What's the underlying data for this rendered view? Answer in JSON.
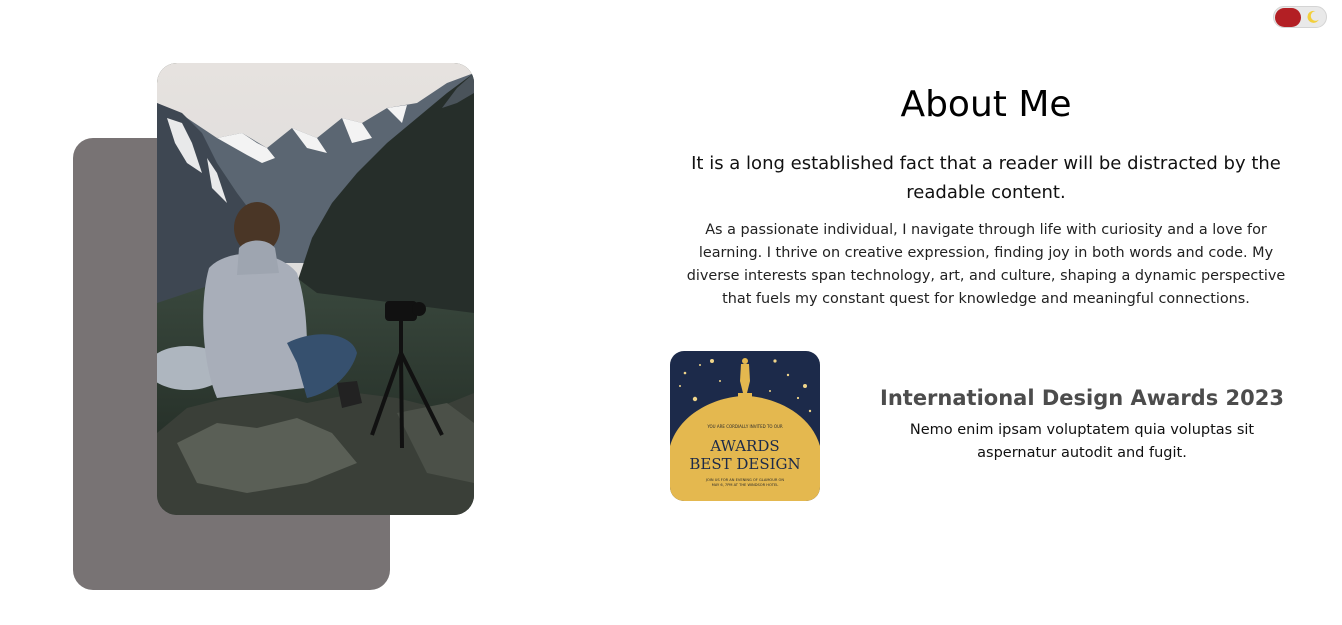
{
  "theme_toggle": {
    "knob_color": "#b31f24",
    "icon": "moon-icon"
  },
  "about": {
    "title": "About Me",
    "lead": "It is a long established fact that a reader will be distracted by the readable content.",
    "body": "As a passionate individual, I navigate through life with curiosity and a love for learning. I thrive on creative expression, finding joy in both words and code. My diverse interests span technology, art, and culture, shaping a dynamic perspective that fuels my constant quest for knowledge and meaningful connections."
  },
  "award": {
    "badge": {
      "top_line": "YOU ARE CORDIALLY INVITED TO OUR",
      "line1": "AWARDS",
      "line2": "BEST DESIGN",
      "bottom_line1": "JOIN US FOR AN EVENING OF GLAMOUR ON",
      "bottom_line2": "MAY 6, 7PM AT THE WINDSOR HOTEL",
      "navy": "#1c2a4a",
      "gold": "#e4b84f"
    },
    "title": "International Design Awards 2023",
    "description": "Nemo enim ipsam voluptatem quia voluptas sit aspernatur autodit and fugit."
  },
  "colors": {
    "back_card": "#787374",
    "accent": "#b31f24"
  }
}
